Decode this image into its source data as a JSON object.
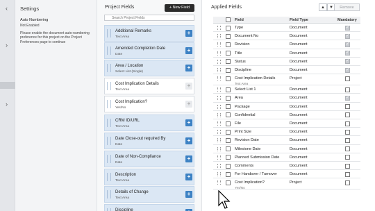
{
  "settings": {
    "title": "Settings",
    "auto_numbering_label": "Auto Numbering",
    "auto_numbering_value": "Not Enabled",
    "help_text": "Please enable the document auto-numbering preference for this project on the Project Preferences page to continue"
  },
  "project_fields": {
    "title": "Project Fields",
    "new_field_label": "+ New Field",
    "search_placeholder": "Search Project Fields",
    "cards": [
      {
        "name": "Additional Remarks",
        "type": "Text Area",
        "added": false
      },
      {
        "name": "Amended Completion Date",
        "type": "Date",
        "added": false
      },
      {
        "name": "Area / Location",
        "type": "Select List (Single)",
        "added": false
      },
      {
        "name": "Cost Implication Details",
        "type": "Text Area",
        "added": true
      },
      {
        "name": "Cost Implication?",
        "type": "Yes/No",
        "added": true
      },
      {
        "name": "CRM ID/URL",
        "type": "Text Area",
        "added": false
      },
      {
        "name": "Date Close-out required By",
        "type": "Date",
        "added": false
      },
      {
        "name": "Date of Non-Compliance",
        "type": "Date",
        "added": false
      },
      {
        "name": "Description",
        "type": "Text Area",
        "added": false
      },
      {
        "name": "Details of Change",
        "type": "Text Area",
        "added": false
      },
      {
        "name": "Discipline",
        "type": "",
        "added": false
      }
    ]
  },
  "applied_fields": {
    "title": "Applied Fields",
    "move_up_glyph": "▲",
    "move_down_glyph": "▼",
    "remove_label": "Remove",
    "headers": {
      "field": "Field",
      "type": "Field Type",
      "mandatory": "Mandatory"
    },
    "rows": [
      {
        "name": "Type",
        "sub": "",
        "type": "Document",
        "mandatory": true
      },
      {
        "name": "Document No",
        "sub": "",
        "type": "Document",
        "mandatory": true
      },
      {
        "name": "Revision",
        "sub": "",
        "type": "Document",
        "mandatory": true
      },
      {
        "name": "Title",
        "sub": "",
        "type": "Document",
        "mandatory": true
      },
      {
        "name": "Status",
        "sub": "",
        "type": "Document",
        "mandatory": true
      },
      {
        "name": "Discipline",
        "sub": "",
        "type": "Document",
        "mandatory": true
      },
      {
        "name": "Cost Implication Details",
        "sub": "Text Area",
        "type": "Project",
        "mandatory": false
      },
      {
        "name": "Select List 1",
        "sub": "",
        "type": "Document",
        "mandatory": false
      },
      {
        "name": "Area",
        "sub": "",
        "type": "Document",
        "mandatory": true
      },
      {
        "name": "Package",
        "sub": "",
        "type": "Document",
        "mandatory": false
      },
      {
        "name": "Confidential",
        "sub": "",
        "type": "Document",
        "mandatory": false
      },
      {
        "name": "File",
        "sub": "",
        "type": "Document",
        "mandatory": false
      },
      {
        "name": "Print Size",
        "sub": "",
        "type": "Document",
        "mandatory": false
      },
      {
        "name": "Revision Date",
        "sub": "",
        "type": "Document",
        "mandatory": false
      },
      {
        "name": "Milestone Date",
        "sub": "",
        "type": "Document",
        "mandatory": false
      },
      {
        "name": "Planned Submission Date",
        "sub": "",
        "type": "Document",
        "mandatory": false
      },
      {
        "name": "Comments",
        "sub": "",
        "type": "Document",
        "mandatory": false
      },
      {
        "name": "For Handover / Turnover",
        "sub": "",
        "type": "Document",
        "mandatory": false
      },
      {
        "name": "Cost Implication?",
        "sub": "Yes/No",
        "type": "Project",
        "mandatory": false
      }
    ]
  },
  "colors": {
    "accent": "#3d82c4",
    "card_bg": "#dbe7f4",
    "new_field_bg": "#2b2b2b"
  }
}
